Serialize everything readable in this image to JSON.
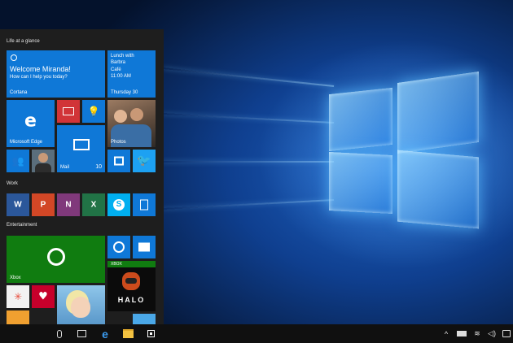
{
  "start_menu": {
    "groups": {
      "life": "Life at a glance",
      "work": "Work",
      "entertainment": "Entertainment"
    },
    "cortana": {
      "greeting": "Welcome Miranda!",
      "subtext": "How can I help you today?",
      "label": "Cortana"
    },
    "calendar": {
      "event": "Lunch with",
      "person": "Barbra",
      "place": "Café",
      "time": "11:00 AM",
      "day": "Thursday 30"
    },
    "edge": {
      "label": "Microsoft Edge"
    },
    "mail": {
      "label": "Mail",
      "count": "10"
    },
    "photos": {
      "label": "Photos"
    },
    "xbox": {
      "label": "Xbox",
      "badge": "XBOX"
    },
    "halo": {
      "label": "HALO"
    }
  },
  "icons": {
    "search": "microphone-icon",
    "task_view": "task-view-icon",
    "edge": "edge-icon",
    "explorer": "file-explorer-icon",
    "store": "store-icon",
    "tray_up": "chevron-up-icon",
    "battery": "battery-icon",
    "network": "wifi-icon",
    "volume": "volume-icon",
    "notifications": "action-center-icon"
  },
  "colors": {
    "accent": "#0f78d7",
    "tile_dark": "#0063b1",
    "xbox_green": "#107c10",
    "word": "#2b579a",
    "powerpoint": "#d24726",
    "onenote": "#80397b",
    "excel": "#217346",
    "skype": "#00aff0",
    "twitter": "#1da1f2"
  }
}
